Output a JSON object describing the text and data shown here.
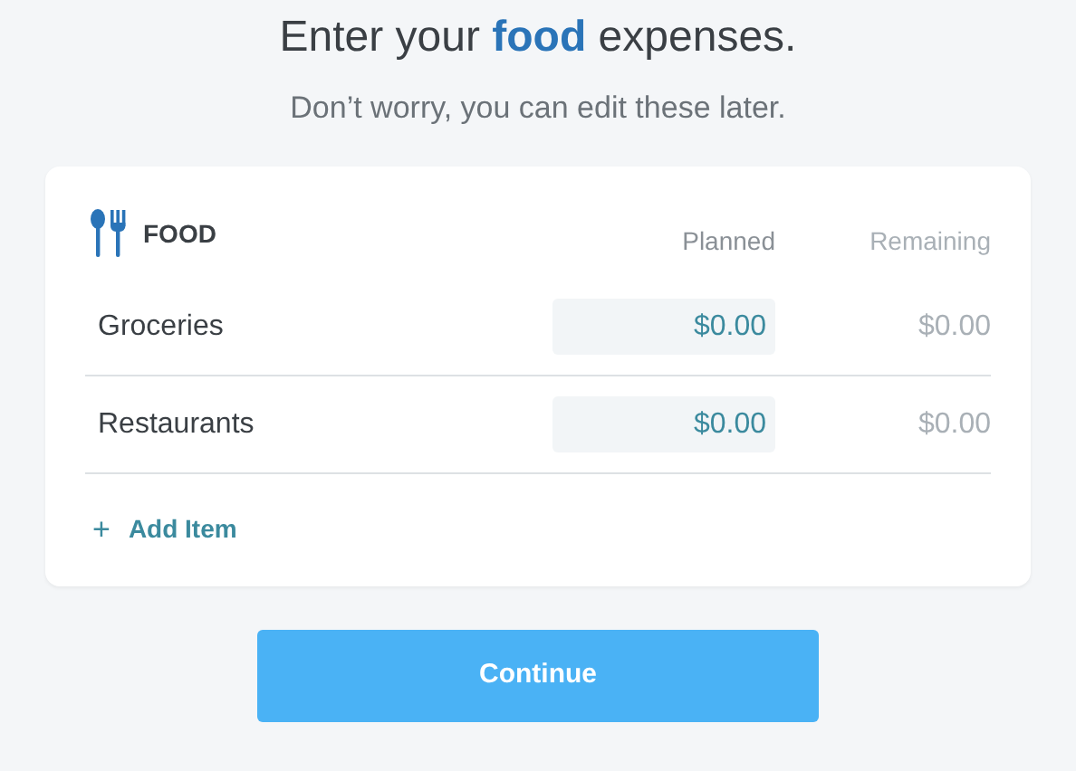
{
  "heading": "Enter your **food** expenses.",
  "subheading": "Don’t worry, you can edit these later.",
  "card": {
    "title": "FOOD",
    "columns": [
      "Planned",
      "Remaining"
    ],
    "rows": [
      {
        "name": "Groceries",
        "planned": "$0.00",
        "remaining": "$0.00"
      },
      {
        "name": "Restaurants",
        "planned": "$0.00",
        "remaining": "$0.00"
      }
    ],
    "add_item": {
      "icon": "+",
      "label": "Add Item"
    }
  },
  "button": "Continue"
}
